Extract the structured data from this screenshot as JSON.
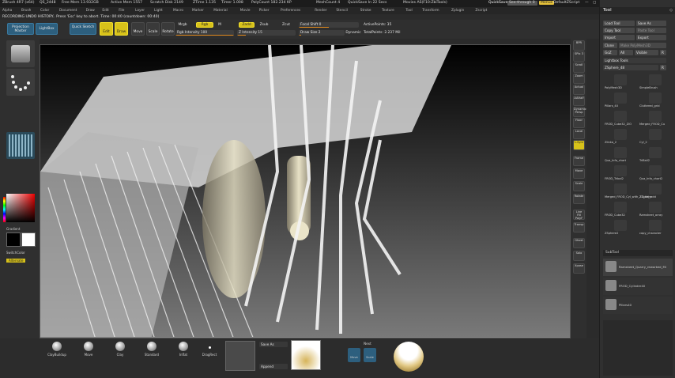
{
  "titlebar": {
    "app": "ZBrush 4R7 (x64)",
    "items": [
      "QS_2448",
      "Free Mem 13.932GB",
      "Active Mem 1557",
      "Scratch Disk 2149",
      "ZTime 1.135",
      "Timer 1.008",
      "PolyCount 182.234 KP",
      "MeshCount 4",
      "QuickSave In 22 Secs",
      "Movies AS(F10:ZbiTools)"
    ],
    "quicksave": "QuickSave",
    "seethrough_label": "See-through",
    "seethrough_value": "0",
    "menus_label": "Menus",
    "script_label": "DefaultZScript"
  },
  "menubar": [
    "Alpha",
    "Brush",
    "Color",
    "Document",
    "Draw",
    "Edit",
    "File",
    "Layer",
    "Light",
    "Macro",
    "Marker",
    "Material",
    "Movie",
    "Picker",
    "Preferences",
    "Render",
    "Stencil",
    "Stroke",
    "Texture",
    "Tool",
    "Transform",
    "Zplugin",
    "Zscript"
  ],
  "notice": "RECORDING UNDO HISTORY.. Press 'Esc' key to abort. Time: 00:40 (countdown: 00:40)",
  "shelf": {
    "projection_master": "Projection Master",
    "lightbox": "LightBox",
    "quick_sketch": "Quick Sketch",
    "edit": "Edit",
    "draw": "Draw",
    "move": "Move",
    "scale": "Scale",
    "rotate": "Rotate",
    "mrgb": "Mrgb",
    "rgb": "Rgb",
    "m": "M",
    "zadd": "Zadd",
    "zsub": "Zsub",
    "zcut": "Zcut",
    "rgb_intensity": "Rgb Intensity 100",
    "z_intensity": "Z Intensity 15",
    "focal_shift": "Focal Shift 0",
    "draw_size": "Draw Size 2",
    "dynamic": "Dynamic",
    "active_points": "ActivePoints: 35",
    "total_points": "TotalPoints: 2.237 Mil"
  },
  "left": {
    "gradient": "Gradient",
    "switch_color": "SwitchColor",
    "alternate": "Alternate"
  },
  "right_shelf": [
    "BPR",
    "SPix 3",
    "Scroll",
    "Zoom",
    "Actual",
    "AAHalf",
    "Dynamic Persp",
    "Floor",
    "Local",
    "L.Sym",
    "Frame",
    "Move",
    "Scale",
    "Rotate",
    "Line Fill PolyF",
    "Transp",
    "Ghost",
    "Solo",
    "Xpose"
  ],
  "tool_panel": {
    "header": "Tool",
    "load_tool": "Load Tool",
    "save_as": "Save As",
    "copy_tool": "Copy Tool",
    "paste_tool": "Paste Tool",
    "import": "Import",
    "export": "Export",
    "clone": "Clone",
    "make_polymesh": "Make PolyMesh3D",
    "goz": "GoZ",
    "all": "All",
    "visible": "Visible",
    "r": "R",
    "lightbox_tools": "Lightbox Tools",
    "zsphere_label": "ZSphere_48",
    "r_label": "R",
    "tools": [
      "PolyMesh3D",
      "SimpleBrush",
      "Pillars_40",
      "Cluttered_grid",
      "FROD_Cube32_ZiO",
      "Merged_FROD_Cu",
      "Zlinka_2",
      "Cyl_2",
      "Qua_Info_chart",
      "TriBall2",
      "FROD_Tribal2",
      "Qua_Info_chart2",
      "Merged_FROD_Cyl_with_ZZ_obj_add",
      "ZSphere",
      "FROD_Cube32",
      "Ramsheet_array",
      "ZSphere2",
      "copy_character"
    ],
    "subtool_header": "SubTool",
    "subtools": [
      "Ramsheet_Quarry_reworked_Mi",
      "FROD_Cylinder40",
      "Pillars40"
    ],
    "lr": "L R"
  },
  "bottom": {
    "brushes": [
      "ClayBuildup",
      "Move",
      "Clay",
      "Standard",
      "Inflat"
    ],
    "dots": "DragRect",
    "alpha_off": "Alpha Off",
    "texture_off": "Texture Off",
    "save_as": "Save As",
    "append": "Append",
    "next": "Next",
    "move": "Move",
    "scale": "Scale"
  },
  "colors": {
    "accent": "#e08a1e",
    "blue": "#2d5f7e",
    "yellow": "#d8c21a"
  }
}
